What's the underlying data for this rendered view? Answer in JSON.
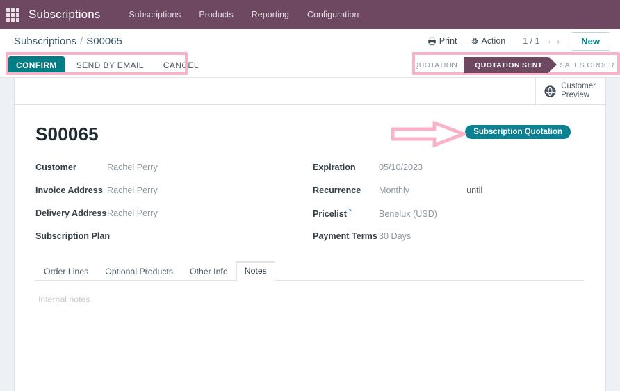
{
  "navbar": {
    "apps_icon": "apps-grid-icon",
    "brand": "Subscriptions",
    "menu": [
      {
        "label": "Subscriptions"
      },
      {
        "label": "Products"
      },
      {
        "label": "Reporting"
      },
      {
        "label": "Configuration"
      }
    ]
  },
  "breadcrumb": {
    "root": "Subscriptions",
    "separator": "/",
    "current": "S00065"
  },
  "control_panel": {
    "print_label": "Print",
    "print_icon": "printer-icon",
    "action_label": "Action",
    "action_icon": "gear-icon",
    "pager": "1 / 1",
    "prev_icon": "chevron-left-icon",
    "next_icon": "chevron-right-icon",
    "new_label": "New"
  },
  "actions": {
    "confirm_label": "CONFIRM",
    "send_by_email_label": "SEND BY EMAIL",
    "cancel_label": "CANCEL"
  },
  "statusbar": {
    "stages": [
      {
        "label": "QUOTATION",
        "active": false
      },
      {
        "label": "QUOTATION SENT",
        "active": true
      },
      {
        "label": "SALES ORDER",
        "active": false
      }
    ]
  },
  "button_box": {
    "customer_preview_label": "Customer\nPreview",
    "customer_preview_line1": "Customer",
    "customer_preview_line2": "Preview",
    "customer_preview_icon": "globe-icon"
  },
  "record": {
    "title": "S00065",
    "ribbon": "Subscription Quotation"
  },
  "form": {
    "left": [
      {
        "label": "Customer",
        "value": "Rachel Perry"
      },
      {
        "label": "Invoice Address",
        "value": "Rachel Perry"
      },
      {
        "label": "Delivery Address",
        "value": "Rachel Perry"
      },
      {
        "label": "Subscription Plan",
        "value": ""
      }
    ],
    "right": [
      {
        "label": "Expiration",
        "value": "05/10/2023"
      },
      {
        "label": "Recurrence",
        "value": "Monthly",
        "extra": "until"
      },
      {
        "label": "Pricelist",
        "value": "Benelux (USD)",
        "help": "?"
      },
      {
        "label": "Payment Terms",
        "value": "30 Days"
      }
    ]
  },
  "notebook": {
    "tabs": [
      {
        "label": "Order Lines",
        "active": false
      },
      {
        "label": "Optional Products",
        "active": false
      },
      {
        "label": "Other Info",
        "active": false
      },
      {
        "label": "Notes",
        "active": true
      }
    ],
    "notes_placeholder": "Internal notes"
  },
  "annotations": {
    "highlight_color": "#f9b3c8",
    "arrow_name": "pink-arrow-annotation"
  },
  "colors": {
    "navbar_purple": "#6e4860",
    "primary_teal": "#017e84",
    "ribbon_teal": "#0b8191",
    "annotation_pink": "#f9b3c8"
  }
}
